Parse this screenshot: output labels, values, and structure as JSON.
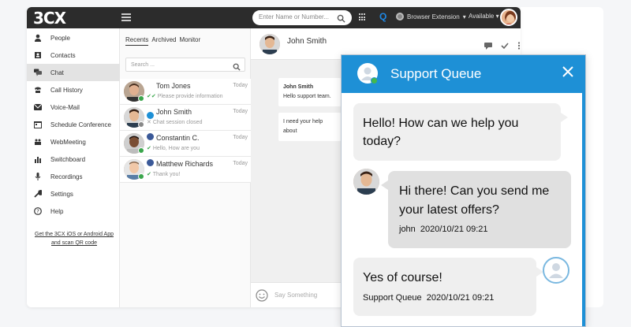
{
  "app": {
    "logo": "3CX",
    "search_placeholder": "Enter Name or Number...",
    "browser_extension": "Browser Extension",
    "presence": "Available"
  },
  "sidebar": {
    "items": [
      {
        "label": "People",
        "icon": "person-icon"
      },
      {
        "label": "Contacts",
        "icon": "contacts-icon"
      },
      {
        "label": "Chat",
        "icon": "chat-icon",
        "active": true
      },
      {
        "label": "Call History",
        "icon": "phone-icon"
      },
      {
        "label": "Voice-Mail",
        "icon": "voicemail-icon"
      },
      {
        "label": "Schedule Conference",
        "icon": "calendar-icon"
      },
      {
        "label": "WebMeeting",
        "icon": "webmeeting-icon"
      },
      {
        "label": "Switchboard",
        "icon": "switchboard-icon"
      },
      {
        "label": "Recordings",
        "icon": "microphone-icon"
      },
      {
        "label": "Settings",
        "icon": "wrench-icon"
      },
      {
        "label": "Help",
        "icon": "help-icon"
      }
    ],
    "app_link": "Get the 3CX iOS or Android App and scan QR code"
  },
  "chatlist": {
    "tabs": [
      "Recents",
      "Archived",
      "Monitor"
    ],
    "active_tab": "Recents",
    "search_placeholder": "Search ...",
    "conversations": [
      {
        "name": "Tom Jones",
        "time": "Today",
        "preview": "Please provide information",
        "status_color": "#3aa64c",
        "channel": "livechat",
        "preview_icon": "double-check"
      },
      {
        "name": "John Smith",
        "time": "Today",
        "preview": "Chat session closed",
        "status_color": "#888888",
        "channel": "livechat",
        "preview_icon": "x"
      },
      {
        "name": "Constantin C.",
        "time": "Today",
        "preview": "Hello, How are you",
        "status_color": "#3aa64c",
        "channel": "facebook",
        "preview_icon": "check"
      },
      {
        "name": "Matthew Richards",
        "time": "Today",
        "preview": "Thank you!",
        "status_color": "#3aa64c",
        "channel": "facebook",
        "preview_icon": "check"
      }
    ]
  },
  "conversation": {
    "contact_name": "John Smith",
    "messages": [
      {
        "sender": "John Smith",
        "text": "Hello support team."
      },
      {
        "sender": "",
        "text": "I need your help about"
      }
    ],
    "compose_placeholder": "Say Something"
  },
  "widget": {
    "title": "Support Queue",
    "accent": "#1e90d6",
    "messages": [
      {
        "side": "left",
        "text": "Hello! How can we help you today?"
      },
      {
        "side": "right",
        "text": "Hi there! Can you send me your latest offers?",
        "meta": "john  2020/10/21 09:21"
      },
      {
        "side": "left",
        "text": "Yes of course!",
        "meta": "Support Queue  2020/10/21 09:21"
      }
    ]
  }
}
